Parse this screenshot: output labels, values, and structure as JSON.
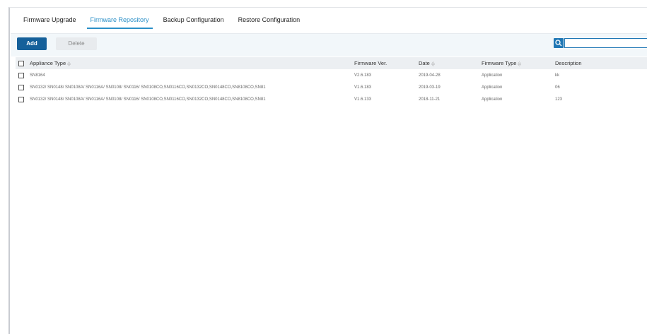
{
  "tabs": [
    {
      "label": "Firmware Upgrade"
    },
    {
      "label": "Firmware Repository"
    },
    {
      "label": "Backup Configuration"
    },
    {
      "label": "Restore Configuration"
    }
  ],
  "active_tab": 1,
  "toolbar": {
    "add_label": "Add",
    "delete_label": "Delete",
    "search_value": "",
    "search_icon": "search-icon"
  },
  "table": {
    "columns": [
      "Appliance Type",
      "Firmware Ver.",
      "Date",
      "Firmware Type",
      "Description"
    ],
    "sortable": [
      true,
      false,
      true,
      true,
      false
    ],
    "rows": [
      {
        "appliance_type": "SN8164",
        "firmware_ver": "V2.6.183",
        "date": "2019-04-28",
        "firmware_type": "Application",
        "description": "kk"
      },
      {
        "appliance_type": "SN0132/ SN0148/ SN0108A/ SN0116A/ SN0108/ SN0116/ SN0108CO,SN0116CO,SN0132CO,SN0148CO,SN8108CO,SN81",
        "firmware_ver": "V1.6.183",
        "date": "2019-03-19",
        "firmware_type": "Application",
        "description": "06"
      },
      {
        "appliance_type": "SN0132/ SN0148/ SN0108A/ SN0116A/ SN0108/ SN0116/ SN0108CO,SN0116CO,SN0132CO,SN0148CO,SN8108CO,SN81",
        "firmware_ver": "V1.6.133",
        "date": "2018-11-21",
        "firmware_type": "Application",
        "description": "123"
      }
    ]
  },
  "colors": {
    "accent": "#2a8fc7",
    "add_button": "#15609a",
    "toolbar_bg": "#f2f7fa",
    "header_bg": "#eceff2"
  }
}
